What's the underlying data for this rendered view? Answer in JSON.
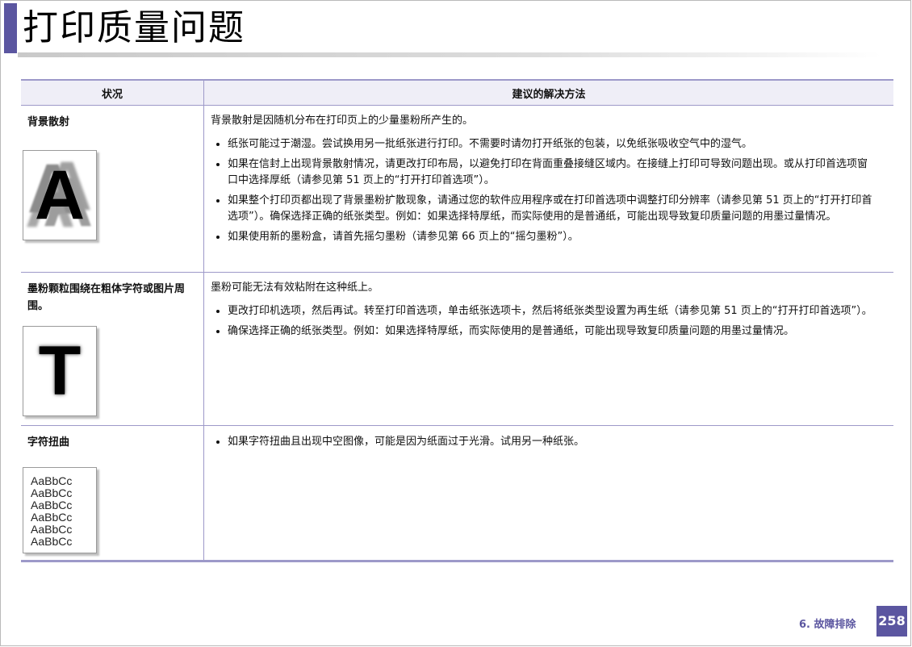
{
  "page": {
    "title": "打印质量问题",
    "footer_section": "6. 故障排除",
    "page_number": "258",
    "accent_color": "#5b56a0",
    "rule_color": "#9d99c9"
  },
  "table": {
    "header_condition": "状况",
    "header_solution": "建议的解决方法",
    "rows": [
      {
        "condition": "背景散射",
        "sample_glyph": "A",
        "intro": "背景散射是因随机分布在打印页上的少量墨粉所产生的。",
        "bullets": [
          "纸张可能过于潮湿。尝试换用另一批纸张进行打印。不需要时请勿打开纸张的包装，以免纸张吸收空气中的湿气。",
          "如果在信封上出现背景散射情况，请更改打印布局，以避免打印在背面重叠接缝区域内。在接缝上打印可导致问题出现。或从打印首选项窗口中选择厚纸（请参见第 51 页上的“打开打印首选项”）。",
          "如果整个打印页都出现了背景墨粉扩散现象，请通过您的软件应用程序或在打印首选项中调整打印分辨率（请参见第 51 页上的“打开打印首选项”）。确保选择正确的纸张类型。例如：如果选择特厚纸，而实际使用的是普通纸，可能出现导致复印质量问题的用墨过量情况。",
          "如果使用新的墨粉盒，请首先摇匀墨粉（请参见第 66 页上的“摇匀墨粉”）。"
        ]
      },
      {
        "condition": "墨粉颗粒围绕在粗体字符或图片周围。",
        "sample_glyph": "T",
        "intro": "墨粉可能无法有效粘附在这种纸上。",
        "bullets": [
          "更改打印机选项，然后再试。转至打印首选项，单击纸张选项卡，然后将纸张类型设置为再生纸（请参见第 51 页上的“打开打印首选项”）。",
          "确保选择正确的纸张类型。例如：如果选择特厚纸，而实际使用的是普通纸，可能出现导致复印质量问题的用墨过量情况。"
        ]
      },
      {
        "condition": "字符扭曲",
        "sample_lines": [
          "AaBbCc",
          "AaBbCc",
          "AaBbCc",
          "AaBbCc",
          "AaBbCc",
          "AaBbCc"
        ],
        "bullets": [
          "如果字符扭曲且出现中空图像，可能是因为纸面过于光滑。试用另一种纸张。"
        ]
      }
    ]
  }
}
